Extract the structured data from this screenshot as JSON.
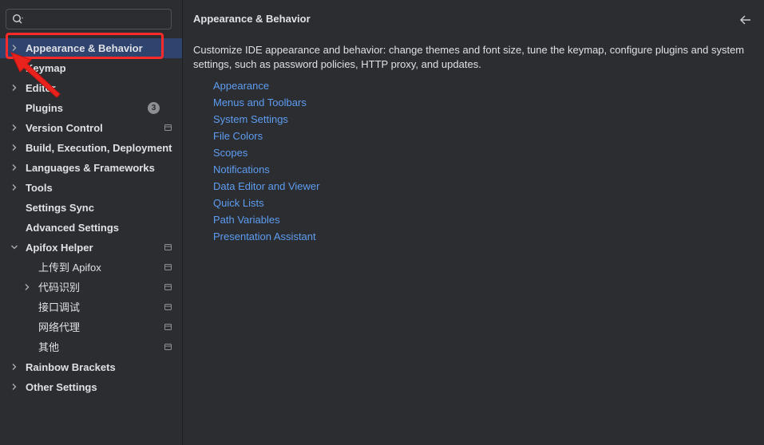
{
  "sidebar": {
    "search": {
      "placeholder": "",
      "value": ""
    },
    "items": [
      {
        "label": "Appearance & Behavior",
        "expandable": true,
        "selected": true
      },
      {
        "label": "Keymap"
      },
      {
        "label": "Editor",
        "expandable": true
      },
      {
        "label": "Plugins",
        "badge": "3"
      },
      {
        "label": "Version Control",
        "expandable": true,
        "project": true
      },
      {
        "label": "Build, Execution, Deployment",
        "expandable": true
      },
      {
        "label": "Languages & Frameworks",
        "expandable": true
      },
      {
        "label": "Tools",
        "expandable": true
      },
      {
        "label": "Settings Sync"
      },
      {
        "label": "Advanced Settings"
      },
      {
        "label": "Apifox Helper",
        "expanded": true,
        "project": true
      },
      {
        "label": "上传到 Apifox",
        "child": true,
        "project": true
      },
      {
        "label": "代码识别",
        "child": true,
        "expandable": true,
        "project": true
      },
      {
        "label": "接口调试",
        "child": true,
        "project": true
      },
      {
        "label": "网络代理",
        "child": true,
        "project": true
      },
      {
        "label": "其他",
        "child": true,
        "project": true
      },
      {
        "label": "Rainbow Brackets",
        "expandable": true
      },
      {
        "label": "Other Settings",
        "expandable": true
      }
    ]
  },
  "main": {
    "title": "Appearance & Behavior",
    "description": "Customize IDE appearance and behavior: change themes and font size, tune the keymap, configure plugins and system settings, such as password policies, HTTP proxy, and updates.",
    "links": [
      "Appearance",
      "Menus and Toolbars",
      "System Settings",
      "File Colors",
      "Scopes",
      "Notifications",
      "Data Editor and Viewer",
      "Quick Lists",
      "Path Variables",
      "Presentation Assistant"
    ]
  },
  "colors": {
    "background": "#2b2d30",
    "selection": "#2e436e",
    "link": "#5e9df2",
    "annotation": "#ff2a2a"
  },
  "icons": [
    "search-icon",
    "chevron-right-icon",
    "chevron-down-icon",
    "project-scope-icon",
    "back-arrow-icon"
  ]
}
